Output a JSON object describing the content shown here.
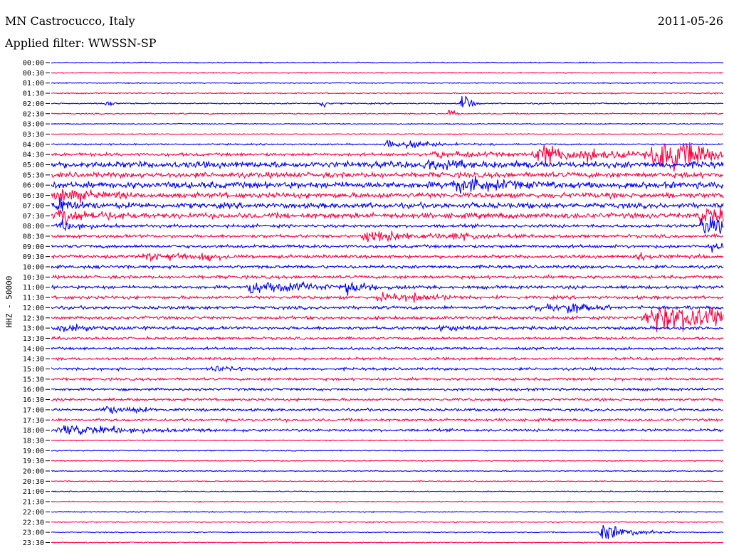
{
  "header": {
    "station": "MN Castrocucco, Italy",
    "date": "2011-05-26",
    "filter": "Applied filter: WWSSN-SP"
  },
  "chart_data": {
    "type": "line",
    "title": "MN Castrocucco, Italy",
    "ylabel": "HHZ - 50000",
    "row_labels": [
      "00:00",
      "00:30",
      "01:00",
      "01:30",
      "02:00",
      "02:30",
      "03:00",
      "03:30",
      "04:00",
      "04:30",
      "05:00",
      "05:30",
      "06:00",
      "06:30",
      "07:00",
      "07:30",
      "08:00",
      "08:30",
      "09:00",
      "09:30",
      "10:00",
      "10:30",
      "11:00",
      "11:30",
      "12:00",
      "12:30",
      "13:00",
      "13:30",
      "14:00",
      "14:30",
      "15:00",
      "15:30",
      "16:00",
      "16:30",
      "17:00",
      "17:30",
      "18:00",
      "18:30",
      "19:00",
      "19:30",
      "20:00",
      "20:30",
      "21:00",
      "21:30",
      "22:00",
      "22:30",
      "23:00",
      "23:30"
    ],
    "series_colors": [
      "#0000ff",
      "#ff0040"
    ],
    "noise_level": [
      1,
      1,
      1,
      1.2,
      1.2,
      1.2,
      1,
      1,
      1.5,
      3,
      6,
      5,
      6,
      5,
      5,
      5,
      3,
      3,
      3,
      3,
      3,
      3,
      3,
      3,
      3,
      3,
      3,
      2.5,
      2.5,
      2.5,
      2.5,
      2.5,
      2.5,
      2.5,
      2.5,
      2.5,
      2.5,
      1,
      1,
      1,
      1,
      1,
      1,
      1,
      1,
      1,
      1,
      1
    ],
    "events": [
      {
        "row": 4,
        "x": 0.08,
        "amp": 10,
        "dur": 0.004
      },
      {
        "row": 4,
        "x": 0.4,
        "amp": 12,
        "dur": 0.004
      },
      {
        "row": 4,
        "x": 0.61,
        "amp": 25,
        "dur": 0.005
      },
      {
        "row": 5,
        "x": 0.59,
        "amp": 10,
        "dur": 0.004
      },
      {
        "row": 8,
        "x": 0.5,
        "amp": 8,
        "dur": 0.02
      },
      {
        "row": 8,
        "x": 0.53,
        "amp": 4,
        "dur": 0.03
      },
      {
        "row": 9,
        "x": 0.57,
        "amp": 8,
        "dur": 0.03
      },
      {
        "row": 9,
        "x": 0.73,
        "amp": 14,
        "dur": 0.06
      },
      {
        "row": 9,
        "x": 0.9,
        "amp": 30,
        "dur": 0.04
      },
      {
        "row": 10,
        "x": 0.55,
        "amp": 8,
        "dur": 0.04
      },
      {
        "row": 12,
        "x": 0.6,
        "amp": 12,
        "dur": 0.05
      },
      {
        "row": 13,
        "x": 0.01,
        "amp": 14,
        "dur": 0.03
      },
      {
        "row": 14,
        "x": 0.01,
        "amp": 12,
        "dur": 0.02
      },
      {
        "row": 15,
        "x": 0.01,
        "amp": 14,
        "dur": 0.03
      },
      {
        "row": 15,
        "x": 0.97,
        "amp": 16,
        "dur": 0.04
      },
      {
        "row": 16,
        "x": 0.01,
        "amp": 10,
        "dur": 0.02
      },
      {
        "row": 16,
        "x": 0.97,
        "amp": 14,
        "dur": 0.04
      },
      {
        "row": 17,
        "x": 0.47,
        "amp": 8,
        "dur": 0.05
      },
      {
        "row": 17,
        "x": 0.6,
        "amp": 8,
        "dur": 0.02
      },
      {
        "row": 18,
        "x": 0.98,
        "amp": 8,
        "dur": 0.02
      },
      {
        "row": 19,
        "x": 0.14,
        "amp": 8,
        "dur": 0.03
      },
      {
        "row": 19,
        "x": 0.22,
        "amp": 8,
        "dur": 0.02
      },
      {
        "row": 19,
        "x": 0.87,
        "amp": 6,
        "dur": 0.02
      },
      {
        "row": 22,
        "x": 0.3,
        "amp": 10,
        "dur": 0.05
      },
      {
        "row": 22,
        "x": 0.44,
        "amp": 10,
        "dur": 0.02
      },
      {
        "row": 23,
        "x": 0.49,
        "amp": 6,
        "dur": 0.04
      },
      {
        "row": 23,
        "x": 0.54,
        "amp": 6,
        "dur": 0.02
      },
      {
        "row": 24,
        "x": 0.72,
        "amp": 6,
        "dur": 0.04
      },
      {
        "row": 24,
        "x": 0.77,
        "amp": 8,
        "dur": 0.02
      },
      {
        "row": 25,
        "x": 0.9,
        "amp": 22,
        "dur": 0.08
      },
      {
        "row": 26,
        "x": 0.01,
        "amp": 6,
        "dur": 0.04
      },
      {
        "row": 26,
        "x": 0.58,
        "amp": 5,
        "dur": 0.02
      },
      {
        "row": 30,
        "x": 0.24,
        "amp": 6,
        "dur": 0.02
      },
      {
        "row": 34,
        "x": 0.08,
        "amp": 6,
        "dur": 0.03
      },
      {
        "row": 36,
        "x": 0.02,
        "amp": 10,
        "dur": 0.05
      },
      {
        "row": 46,
        "x": 0.82,
        "amp": 14,
        "dur": 0.02
      }
    ]
  }
}
